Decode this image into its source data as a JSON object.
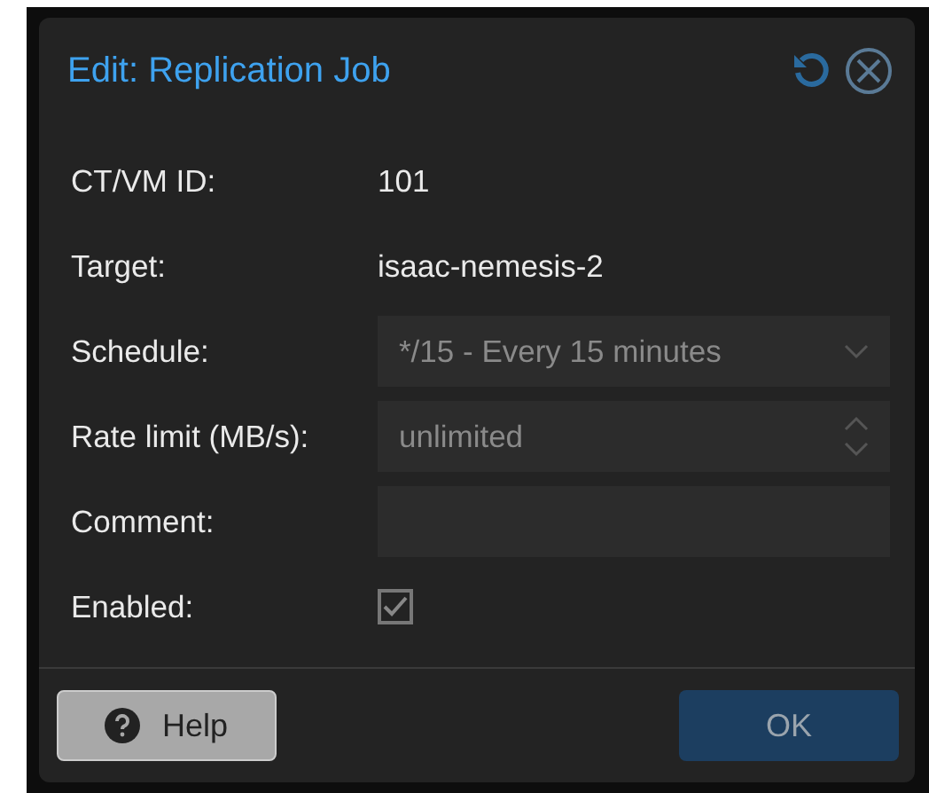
{
  "window": {
    "title": "Edit: Replication Job"
  },
  "fields": [
    {
      "kind": "text",
      "label": "CT/VM ID:",
      "value": "101"
    },
    {
      "kind": "text",
      "label": "Target:",
      "value": "isaac-nemesis-2"
    },
    {
      "kind": "select",
      "label": "Schedule:",
      "value": "*/15 - Every 15 minutes",
      "disabled": true
    },
    {
      "kind": "spinner",
      "label": "Rate limit (MB/s):",
      "placeholder": "unlimited"
    },
    {
      "kind": "input",
      "label": "Comment:"
    },
    {
      "kind": "checkbox",
      "label": "Enabled:",
      "checked": true
    }
  ],
  "buttons": [
    {
      "kind": "help",
      "label": "Help"
    },
    {
      "kind": "ok",
      "label": "OK",
      "disabled": true
    }
  ]
}
